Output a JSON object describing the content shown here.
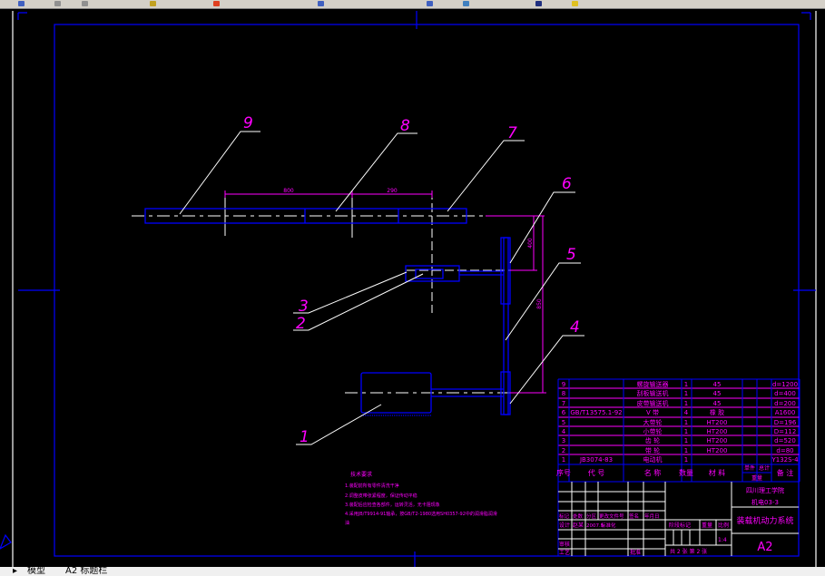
{
  "toolbar": {
    "icons": [
      "new-icon",
      "open-icon",
      "save-icon",
      "print-icon",
      "undo-icon",
      "redo-icon",
      "pan-icon",
      "zoom-icon",
      "properties-icon",
      "layer-icon"
    ]
  },
  "colors": {
    "background": "#000000",
    "frame": "#0000ff",
    "text": "#ff00ff",
    "leader": "#ffffff"
  },
  "drawing": {
    "balloons": [
      "1",
      "2",
      "3",
      "4",
      "5",
      "6",
      "7",
      "8",
      "9"
    ],
    "dimensions": {
      "d1": "800",
      "d2": "290",
      "d3": "400",
      "d4": "850"
    },
    "tech_requirements": {
      "title": "技术要求",
      "lines": [
        "1.装配前所有零件清洗干净",
        "2.调整皮带张紧程度，保证传动平稳",
        "3.装配后应检查各部件，运转灵活，无卡阻现象",
        "4.采用JB/T9914-91轴承，按GB/T2-1980选用SH0357-92中的润滑脂润滑",
        "油"
      ]
    }
  },
  "parts_list": {
    "rows": [
      {
        "no": "9",
        "code": "",
        "name": "螺旋输送器",
        "qty": "1",
        "material": "45",
        "note": "d=1200"
      },
      {
        "no": "8",
        "code": "",
        "name": "刮板输送机",
        "qty": "1",
        "material": "45",
        "note": "d=400"
      },
      {
        "no": "7",
        "code": "",
        "name": "皮带输送机",
        "qty": "1",
        "material": "45",
        "note": "d=200"
      },
      {
        "no": "6",
        "code": "GB/T13575.1-92",
        "name": "V 带",
        "qty": "4",
        "material": "橡 胶",
        "note": "A1600"
      },
      {
        "no": "5",
        "code": "",
        "name": "大带轮",
        "qty": "1",
        "material": "HT200",
        "note": "D=196"
      },
      {
        "no": "4",
        "code": "",
        "name": "小带轮",
        "qty": "1",
        "material": "HT200",
        "note": "D=112"
      },
      {
        "no": "3",
        "code": "",
        "name": "齿 轮",
        "qty": "1",
        "material": "HT200",
        "note": "d=520"
      },
      {
        "no": "2",
        "code": "",
        "name": "带 轮",
        "qty": "1",
        "material": "HT200",
        "note": "d=80"
      },
      {
        "no": "1",
        "code": "JB3074-83",
        "name": "电动机",
        "qty": "1",
        "material": "",
        "note": "Y132S-4"
      }
    ],
    "headers": {
      "no": "序号",
      "code": "代 号",
      "name": "名 称",
      "qty": "数量",
      "material": "材 料",
      "weight_single": "单件",
      "weight_total": "总计",
      "weight": "重量",
      "note": "备 注"
    }
  },
  "title_block": {
    "school": "四川理工学院",
    "class": "机电03-3",
    "title": "装载机动力系统",
    "sheet_size": "A2",
    "sheets": "共 2 张 第 2 张",
    "rev_headers": [
      "标记",
      "处数",
      "分区",
      "更改文件号",
      "签名",
      "年月日"
    ],
    "designer_label": "设计",
    "designer": "赵某",
    "date": "2007.5",
    "std_label": "标准化",
    "review_label": "审核",
    "process_label": "工艺",
    "approve_label": "批准",
    "stage_label": "阶段标记",
    "weight_label": "重量",
    "scale_label": "比例",
    "scale": "1:4"
  },
  "tabs": [
    "模型",
    "A2 标题栏"
  ]
}
